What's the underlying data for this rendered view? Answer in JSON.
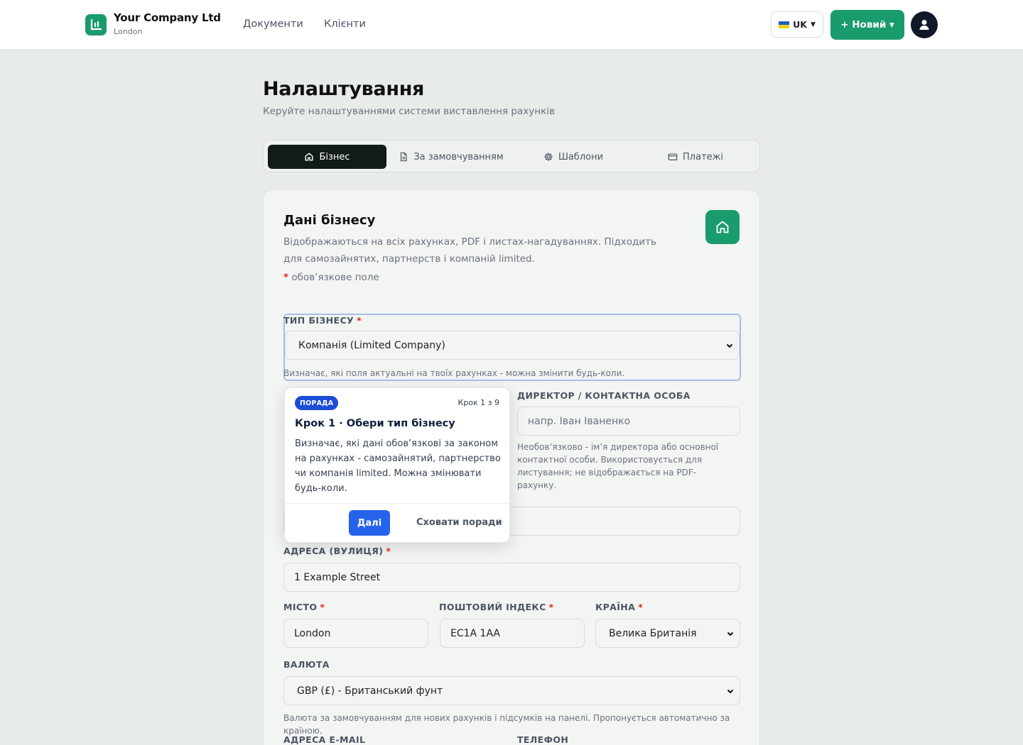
{
  "header": {
    "company_name": "Your Company Ltd",
    "company_city": "London",
    "nav": [
      "Документи",
      "Клієнти"
    ],
    "language": "UK",
    "new_button": "+ Новий ▾"
  },
  "page": {
    "title": "Налаштування",
    "subtitle": "Керуйте налаштуваннями системи виставлення рахунків"
  },
  "tabs": [
    {
      "label": "Бізнес",
      "icon": "home-icon",
      "active": true
    },
    {
      "label": "За замовчуванням",
      "icon": "document-icon",
      "active": false
    },
    {
      "label": "Шаблони",
      "icon": "gear-icon",
      "active": false
    },
    {
      "label": "Платежі",
      "icon": "card-icon",
      "active": false
    }
  ],
  "card": {
    "title": "Дані бізнесу",
    "description": "Відображаються на всіх рахунках, PDF і листах-нагадуваннях. Підходить для самозайнятих, партнерств і компаній limited.",
    "required_note": "обов’язкове поле",
    "required_marker": "*"
  },
  "fields": {
    "business_type": {
      "label": "ТИП БІЗНЕСУ",
      "value": "Компанія (Limited Company)",
      "hint": "Визначає, які поля актуальні на твоїх рахунках - можна змінити будь-коли."
    },
    "director": {
      "label": "ДИРЕКТОР / КОНТАКТНА ОСОБА",
      "placeholder": "напр. Іван Іваненко",
      "hint": "Необов’язково - ім’я директора або основної контактної особи. Використовується для листування; не відображається на PDF-рахунку."
    },
    "address": {
      "label": "АДРЕСА (ВУЛИЦЯ)",
      "value": "1 Example Street"
    },
    "city": {
      "label": "МІСТО",
      "value": "London"
    },
    "postcode": {
      "label": "ПОШТОВИЙ ІНДЕКС",
      "value": "EC1A 1AA"
    },
    "country": {
      "label": "КРАЇНА",
      "value": "Велика Британія"
    },
    "currency": {
      "label": "ВАЛЮТА",
      "value": "GBP (£) - Британський фунт",
      "hint": "Валюта за замовчуванням для нових рахунків і підсумків на панелі. Пропонується автоматично за країною."
    },
    "email": {
      "label": "АДРЕСА E-MAIL"
    },
    "phone": {
      "label": "ТЕЛЕФОН"
    }
  },
  "tooltip": {
    "badge": "ПОРАДА",
    "step": "Крок 1 з 9",
    "title": "Крок 1 · Обери тип бізнесу",
    "body": "Визначає, які дані обов’язкові за законом на рахунках - самозайнятий, партнерство чи компанія limited. Можна змінювати будь-коли.",
    "next_button": "Далі",
    "hide_button": "Сховати поради"
  },
  "colors": {
    "accent": "#1a9b6c",
    "dark": "#111b17",
    "tip_blue": "#2563eb",
    "focus_ring": "#a9bde8",
    "required": "#dc2626"
  }
}
